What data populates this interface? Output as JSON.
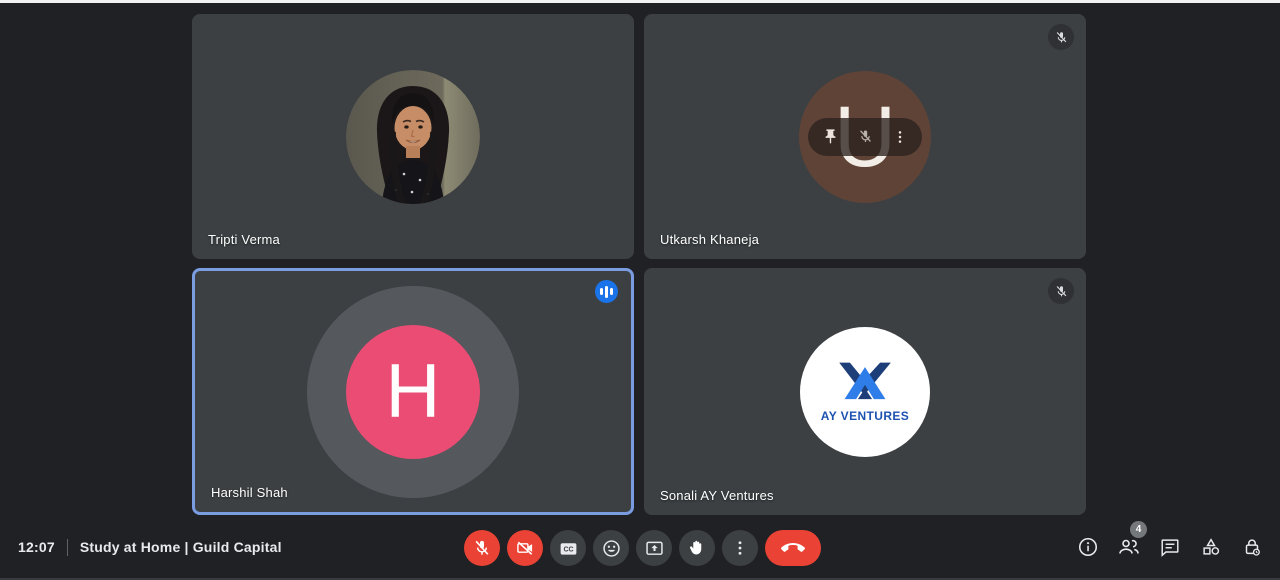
{
  "status_bar": {
    "time": "12:07",
    "meeting_title": "Study at Home | Guild Capital"
  },
  "participants": [
    {
      "name": "Tripti Verma",
      "avatar": "photo",
      "muted": false,
      "speaking": false
    },
    {
      "name": "Utkarsh Khaneja",
      "initial": "U",
      "avatar_color": "#5f4337",
      "muted": true,
      "hover_controls": [
        "pin",
        "mute",
        "more-options"
      ]
    },
    {
      "name": "Harshil Shah",
      "initial": "H",
      "avatar_color": "#ea4c74",
      "muted": false,
      "speaking": true
    },
    {
      "name": "Sonali AY Ventures",
      "avatar": "logo",
      "logo_text": "AY VENTURES",
      "muted": true
    }
  ],
  "controls": {
    "center": [
      {
        "name": "microphone",
        "state": "muted"
      },
      {
        "name": "camera",
        "state": "off"
      },
      {
        "name": "captions",
        "glyph": "CC"
      },
      {
        "name": "reactions"
      },
      {
        "name": "present-screen"
      },
      {
        "name": "raise-hand"
      },
      {
        "name": "more-options"
      },
      {
        "name": "end-call"
      }
    ],
    "right": [
      {
        "name": "meeting-details"
      },
      {
        "name": "people",
        "badge": "4"
      },
      {
        "name": "chat"
      },
      {
        "name": "activities"
      },
      {
        "name": "host-controls"
      }
    ]
  },
  "colors": {
    "background": "#202124",
    "tile": "#3c4043",
    "danger_red": "#ea4335",
    "speaking_border": "#7a9ce0",
    "audio_indicator_blue": "#1a73e8",
    "logo_navy": "#1d3e79",
    "logo_blue": "#2e7de9",
    "logo_wordmark": "#1d52b0"
  }
}
